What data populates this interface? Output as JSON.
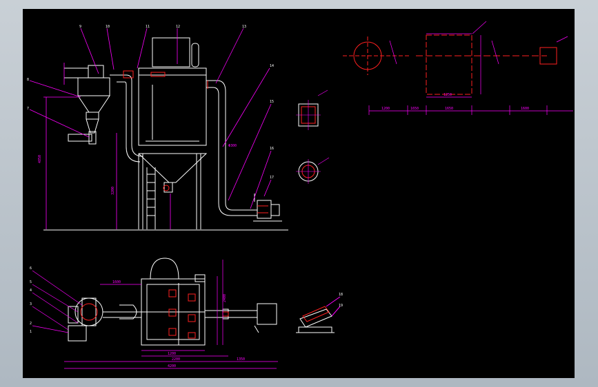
{
  "colors": {
    "frame_top": "#c9d0d6",
    "frame_bottom": "#aeb8c1",
    "sheet": "#000000",
    "outline": "#ffffff",
    "dimension": "#ff00ff",
    "red": "#ff2020",
    "yellow": "#ffff00",
    "green": "#00c000",
    "cyan": "#00ffff"
  },
  "dim_labels": [
    {
      "id": "elev-left",
      "text": "4850"
    },
    {
      "id": "elev-mid",
      "text": "3200"
    },
    {
      "id": "duct-label",
      "text": "Φ300"
    },
    {
      "id": "right-top-1",
      "text": "1200"
    },
    {
      "id": "right-top-2",
      "text": "1650"
    },
    {
      "id": "right-top-3",
      "text": "1650"
    },
    {
      "id": "right-top-4",
      "text": "1600"
    },
    {
      "id": "right-inner",
      "text": "1250"
    },
    {
      "id": "plan-1",
      "text": "4200"
    },
    {
      "id": "plan-2",
      "text": "2200"
    },
    {
      "id": "plan-3",
      "text": "1200"
    },
    {
      "id": "plan-4",
      "text": "1350"
    },
    {
      "id": "plan-5",
      "text": "2400"
    },
    {
      "id": "plan-6",
      "text": "1600"
    }
  ],
  "leaders": [
    "1",
    "2",
    "3",
    "4",
    "5",
    "6",
    "7",
    "8",
    "9",
    "10",
    "11",
    "12",
    "13",
    "14",
    "15",
    "16",
    "17",
    "18",
    "19"
  ]
}
